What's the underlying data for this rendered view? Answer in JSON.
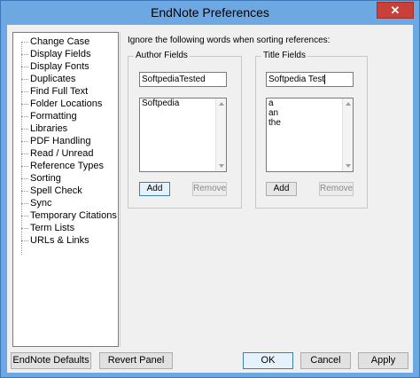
{
  "window": {
    "title": "EndNote Preferences",
    "close_glyph": "✕"
  },
  "sidebar": {
    "items": [
      {
        "label": "Change Case"
      },
      {
        "label": "Display Fields"
      },
      {
        "label": "Display Fonts"
      },
      {
        "label": "Duplicates"
      },
      {
        "label": "Find Full Text"
      },
      {
        "label": "Folder Locations"
      },
      {
        "label": "Formatting"
      },
      {
        "label": "Libraries"
      },
      {
        "label": "PDF Handling"
      },
      {
        "label": "Read / Unread"
      },
      {
        "label": "Reference Types"
      },
      {
        "label": "Sorting"
      },
      {
        "label": "Spell Check"
      },
      {
        "label": "Sync"
      },
      {
        "label": "Temporary Citations"
      },
      {
        "label": "Term Lists"
      },
      {
        "label": "URLs & Links"
      }
    ]
  },
  "panel": {
    "description": "Ignore the following words when sorting references:",
    "author": {
      "legend": "Author Fields",
      "input_value": "SoftpediaTested",
      "list": [
        "Softpedia"
      ],
      "add_label": "Add",
      "remove_label": "Remove"
    },
    "title": {
      "legend": "Title Fields",
      "input_value": "Softpedia Test",
      "list": [
        "a",
        "an",
        "the"
      ],
      "add_label": "Add",
      "remove_label": "Remove"
    }
  },
  "footer": {
    "defaults_label": "EndNote Defaults",
    "revert_label": "Revert Panel",
    "ok_label": "OK",
    "cancel_label": "Cancel",
    "apply_label": "Apply"
  },
  "icons": {
    "close": "close-icon",
    "scroll_up": "scroll-up-arrow-icon",
    "scroll_down": "scroll-down-arrow-icon"
  }
}
